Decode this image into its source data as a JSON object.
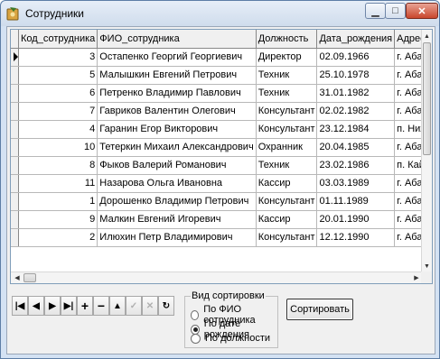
{
  "window": {
    "title": "Сотрудники"
  },
  "grid": {
    "columns": [
      "Код_сотрудника",
      "ФИО_сотрудника",
      "Должность",
      "Дата_рождения",
      "Адрес"
    ],
    "rows": [
      [
        "3",
        "Остапенко Георгий Георгиевич",
        "Директор",
        "02.09.1966",
        "г. Абакан, ул. Ленина"
      ],
      [
        "5",
        "Малышкин Евгений Петрович",
        "Техник",
        "25.10.1978",
        "г. Абакан, ул. Чехова"
      ],
      [
        "6",
        "Петренко Владимир Павлович",
        "Техник",
        "31.01.1982",
        "г. Абакан, ул. Ворош"
      ],
      [
        "7",
        "Гавриков Валентин Олегович",
        "Консультант",
        "02.02.1982",
        "г. Абакан, ул. Петров"
      ],
      [
        "4",
        "Гаранин Егор Викторович",
        "Консультант",
        "23.12.1984",
        "п. Нижняя Согра, ул."
      ],
      [
        "10",
        "Тетеркин Михаил Александрович",
        "Охранник",
        "20.04.1985",
        "г. Абакан, ул. Фукина"
      ],
      [
        "8",
        "Фыков Валерий Романович",
        "Техник",
        "23.02.1986",
        "п. Кайбалы, ул. Ленин"
      ],
      [
        "11",
        "Назарова Ольга Ивановна",
        "Кассир",
        "03.03.1989",
        "г. Абакан, ул. Крылов"
      ],
      [
        "1",
        "Дорошенко Владимир Петрович",
        "Консультант",
        "01.11.1989",
        "г. Абакан, ул. Щетинк"
      ],
      [
        "9",
        "Малкин Евгений Игоревич",
        "Кассир",
        "20.01.1990",
        "г. Абакан, ул. Тельма"
      ],
      [
        "2",
        "Илюхин Петр Владимирович",
        "Консультант",
        "12.12.1990",
        "г. Абакан, ул. Вяткин"
      ]
    ]
  },
  "sort_group": {
    "legend": "Вид сортировки",
    "options": [
      {
        "label": "По ФИО сотрудника",
        "checked": false
      },
      {
        "label": "По дате рождения",
        "checked": true
      },
      {
        "label": "По должности",
        "checked": false
      }
    ]
  },
  "sort_button": "Сортировать",
  "navigator": [
    "first-record-icon",
    "prior-record-icon",
    "next-record-icon",
    "last-record-icon",
    "insert-icon",
    "delete-icon",
    "edit-icon",
    "post-icon",
    "cancel-icon",
    "refresh-icon"
  ]
}
